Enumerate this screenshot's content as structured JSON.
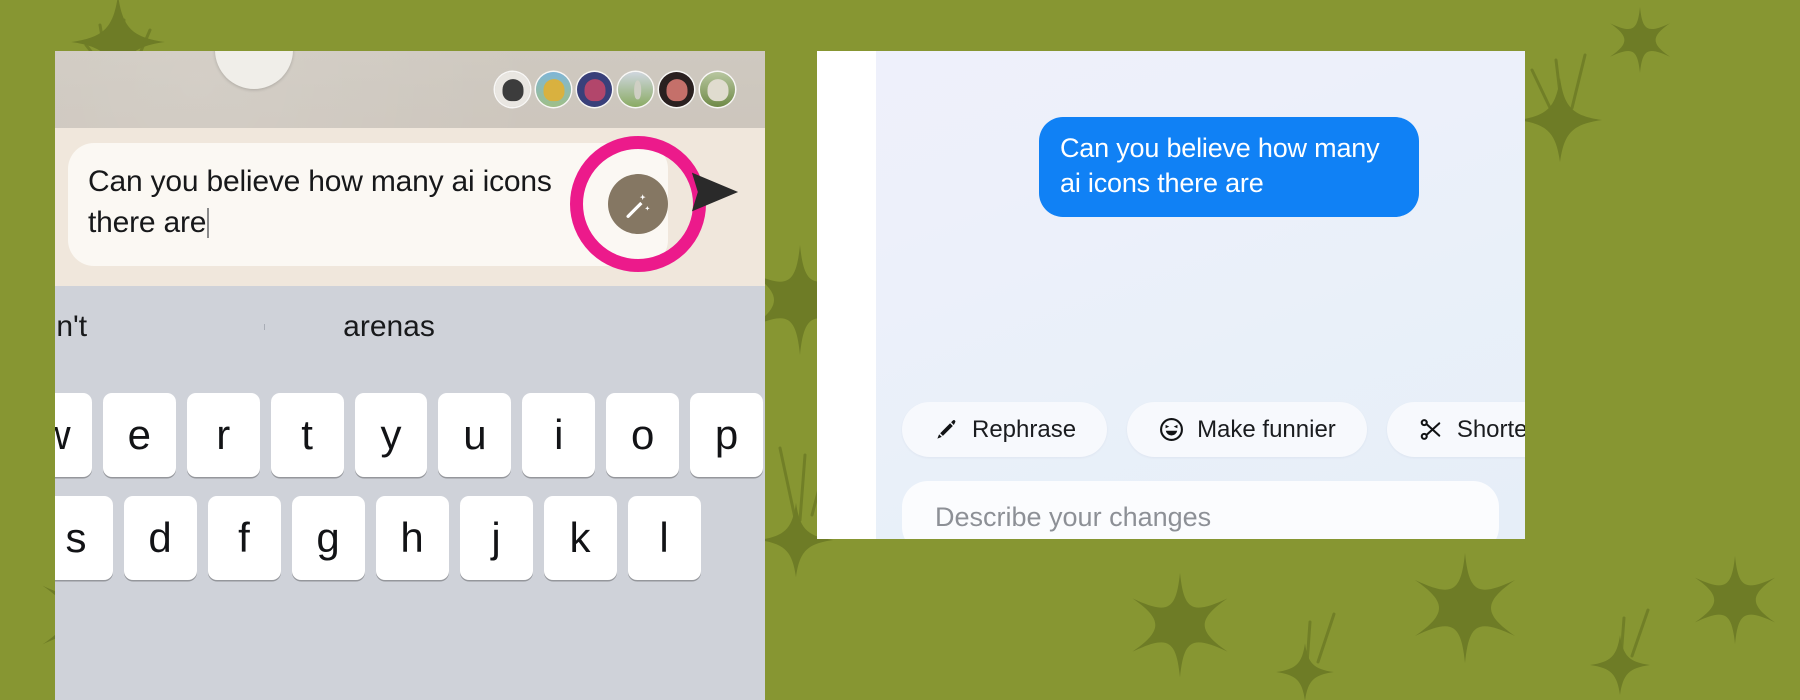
{
  "background": {
    "color": "#879632",
    "deco_color": "#6e7c26",
    "deco_name": "sparkle-pattern"
  },
  "left_screenshot": {
    "name": "messaging-app-composer",
    "header": {
      "name": "group-chat-header",
      "avatars": [
        {
          "name": "avatar-bearded-glasses",
          "bg": "#e9e6e1",
          "face": "#3c3c3c"
        },
        {
          "name": "avatar-sunglasses-yellow",
          "bg": "#7fb6d8",
          "face": "#d9b13f"
        },
        {
          "name": "avatar-group-photo",
          "bg": "#39407a",
          "face": "#b2466b"
        },
        {
          "name": "avatar-landscape",
          "bg": "#8aab63",
          "face": "#cfcfc4"
        },
        {
          "name": "avatar-portrait-red",
          "bg": "#2a2020",
          "face": "#c5706a"
        },
        {
          "name": "avatar-outdoors",
          "bg": "#6f8a47",
          "face": "#e0dccf"
        }
      ]
    },
    "composer": {
      "message_text": "Can you believe how many ai icons there are",
      "magic_button_label": "magic-wand",
      "send_button_label": "send",
      "highlight_color": "#ec1a8b",
      "magic_button_color": "#857763"
    },
    "keyboard": {
      "suggestions": [
        "aren't",
        "arenas",
        ""
      ],
      "row_1": [
        "w",
        "e",
        "r",
        "t",
        "y",
        "u",
        "i",
        "o",
        "p"
      ],
      "row_2": [
        "s",
        "d",
        "f",
        "g",
        "h",
        "j",
        "k",
        "l"
      ]
    }
  },
  "right_screenshot": {
    "name": "ai-writing-assistant-panel",
    "message": {
      "text": "Can you believe how many ai icons there are",
      "bubble_color": "#1081f5"
    },
    "actions": [
      {
        "label": "Rephrase",
        "icon": "pencil-icon"
      },
      {
        "label": "Make funnier",
        "icon": "smiley-icon"
      },
      {
        "label": "Shorten",
        "icon": "scissors-icon"
      }
    ],
    "input": {
      "placeholder": "Describe your changes",
      "value": ""
    }
  }
}
